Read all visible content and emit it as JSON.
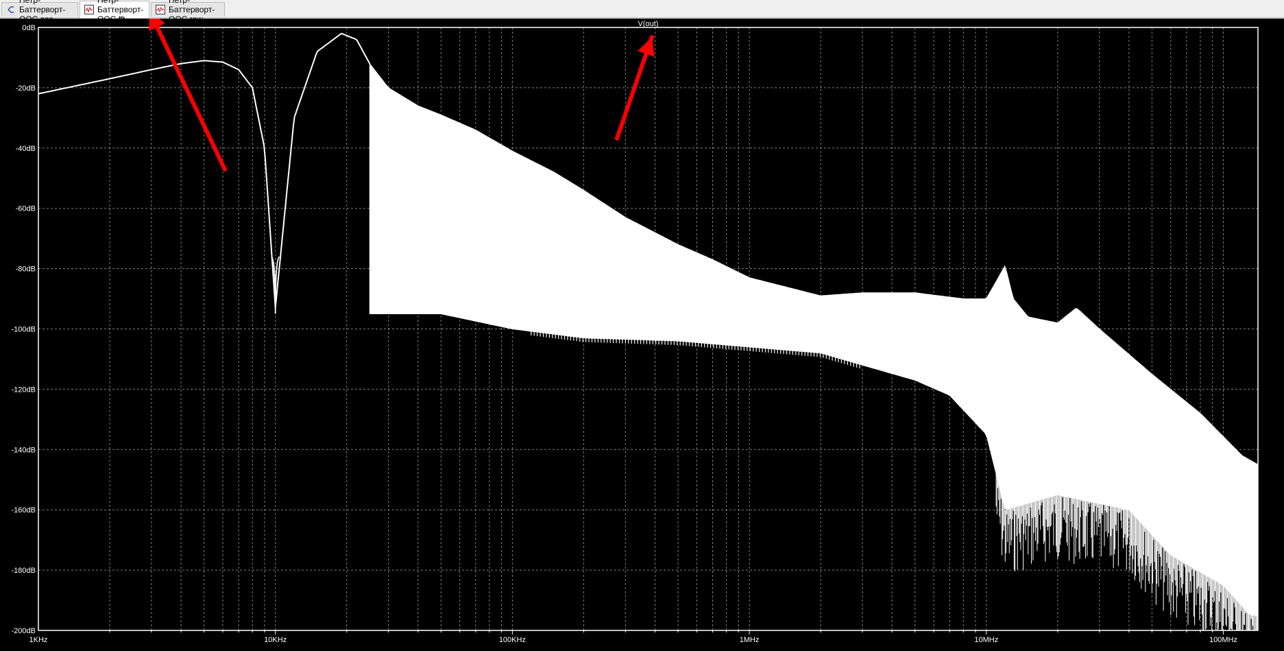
{
  "tabs": [
    {
      "label": "Петр-Баттерворт-ООС.asc",
      "icon": "schematic-icon",
      "active": false
    },
    {
      "label": "Петр-Баттерворт-ООС.fft",
      "icon": "waveform-icon",
      "active": true
    },
    {
      "label": "Петр-Баттерворт-ООС.raw",
      "icon": "waveform-icon",
      "active": false
    }
  ],
  "colors": {
    "background": "#000000",
    "trace": "#ffffff",
    "grid": "#7f7f7f",
    "annotation_arrow": "#ff0000"
  },
  "chart_data": {
    "type": "line",
    "title": "V(out)",
    "xscale": "log",
    "xlim": [
      1000,
      140000000
    ],
    "ylim": [
      -200,
      0
    ],
    "x_tick_labels": [
      "1KHz",
      "10KHz",
      "100KHz",
      "1MHz",
      "10MHz",
      "100MHz"
    ],
    "x_tick_values": [
      1000,
      10000,
      100000,
      1000000,
      10000000,
      100000000
    ],
    "y_tick_labels": [
      "0dB",
      "-20dB",
      "-40dB",
      "-60dB",
      "-80dB",
      "-100dB",
      "-120dB",
      "-140dB",
      "-160dB",
      "-180dB",
      "-200dB"
    ],
    "y_tick_values": [
      0,
      -20,
      -40,
      -60,
      -80,
      -100,
      -120,
      -140,
      -160,
      -180,
      -200
    ],
    "grid": true,
    "grid_style": "dashed",
    "series": [
      {
        "envelope_upper": [
          [
            1000,
            -22
          ],
          [
            2000,
            -17
          ],
          [
            3000,
            -14
          ],
          [
            4000,
            -12
          ],
          [
            5000,
            -11
          ],
          [
            6000,
            -11.5
          ],
          [
            7000,
            -14
          ],
          [
            8000,
            -20
          ],
          [
            9000,
            -40
          ],
          [
            10000,
            -93
          ],
          [
            12000,
            -30
          ],
          [
            15000,
            -8
          ],
          [
            19000,
            -2
          ],
          [
            22000,
            -4
          ],
          [
            25000,
            -12
          ],
          [
            30000,
            -20
          ],
          [
            40000,
            -26
          ],
          [
            50000,
            -29
          ],
          [
            70000,
            -34
          ],
          [
            100000,
            -41
          ],
          [
            150000,
            -48
          ],
          [
            200000,
            -54
          ],
          [
            300000,
            -63
          ],
          [
            500000,
            -72
          ],
          [
            700000,
            -77
          ],
          [
            1000000,
            -83
          ],
          [
            2000000,
            -89
          ],
          [
            3000000,
            -88
          ],
          [
            5000000,
            -88
          ],
          [
            8000000,
            -90
          ],
          [
            10000000,
            -90
          ],
          [
            12000000,
            -79
          ],
          [
            13000000,
            -90
          ],
          [
            15000000,
            -96
          ],
          [
            20000000,
            -98
          ],
          [
            24000000,
            -93
          ],
          [
            30000000,
            -100
          ],
          [
            50000000,
            -115
          ],
          [
            80000000,
            -128
          ],
          [
            120000000,
            -142
          ],
          [
            140000000,
            -145
          ]
        ],
        "envelope_lower": [
          [
            30000,
            -95
          ],
          [
            50000,
            -95
          ],
          [
            100000,
            -100
          ],
          [
            200000,
            -103
          ],
          [
            500000,
            -104
          ],
          [
            1000000,
            -106
          ],
          [
            2000000,
            -108
          ],
          [
            3000000,
            -112
          ],
          [
            5000000,
            -117
          ],
          [
            7000000,
            -122
          ],
          [
            10000000,
            -135
          ],
          [
            12000000,
            -160
          ],
          [
            20000000,
            -155
          ],
          [
            40000000,
            -160
          ],
          [
            60000000,
            -175
          ],
          [
            100000000,
            -185
          ],
          [
            130000000,
            -195
          ]
        ],
        "nulls_freq": [
          10000,
          30000,
          40000,
          50000,
          60000,
          70000,
          80000,
          90000,
          100000,
          110000
        ]
      }
    ]
  }
}
